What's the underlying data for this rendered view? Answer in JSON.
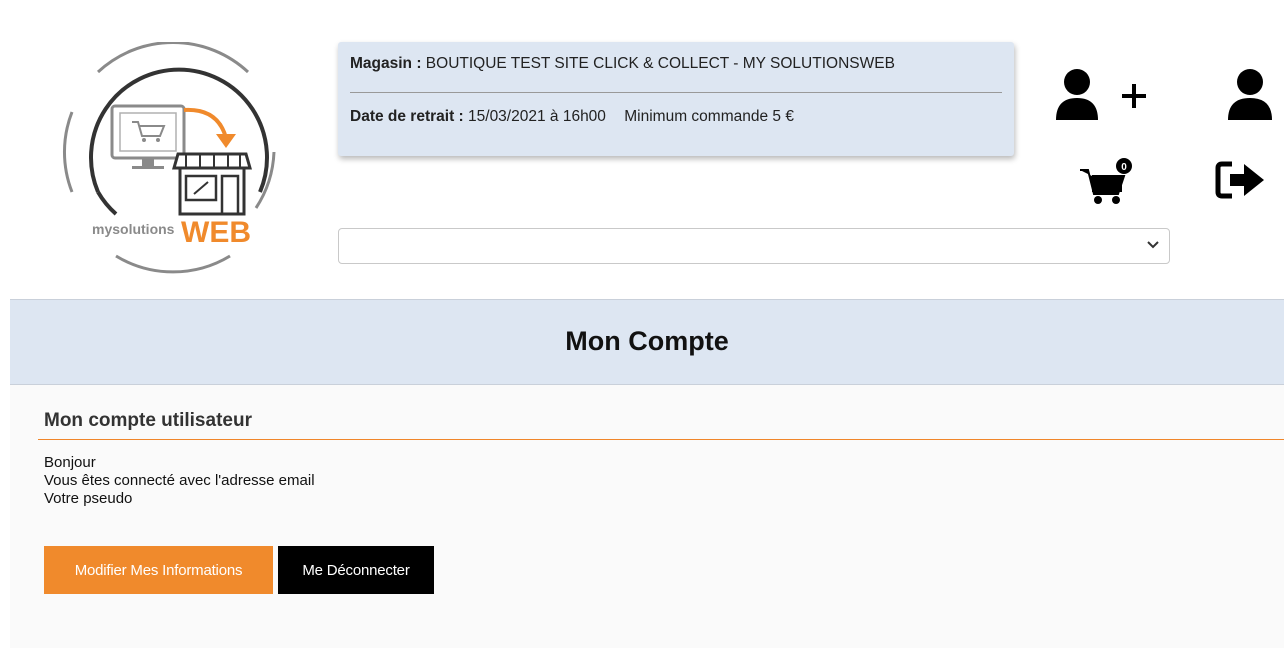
{
  "logo": {
    "text_left": "mysolutions",
    "text_right": "WEB",
    "accent_color": "#f08a2c"
  },
  "store": {
    "magasin_label": "Magasin :",
    "magasin_value": "BOUTIQUE TEST SITE CLICK & COLLECT - MY SOLUTIONSWEB",
    "date_label": "Date de retrait :",
    "date_value": "15/03/2021 à 16h00",
    "minimum": "Minimum commande 5 €"
  },
  "header_icons": {
    "add_user": "add-user-icon",
    "user": "user-icon",
    "cart": "cart-icon",
    "cart_count": "0",
    "logout": "logout-icon"
  },
  "store_select": {
    "selected": ""
  },
  "page": {
    "title": "Mon Compte"
  },
  "account": {
    "section_title": "Mon compte utilisateur",
    "greeting": "Bonjour",
    "email_line": "Vous êtes connecté avec l'adresse email",
    "pseudo_line": "Votre pseudo"
  },
  "buttons": {
    "edit_label": "Modifier Mes Informations",
    "logout_label": "Me Déconnecter"
  },
  "colors": {
    "band": "#dde6f2",
    "orange": "#f08a2c",
    "black": "#000000"
  }
}
